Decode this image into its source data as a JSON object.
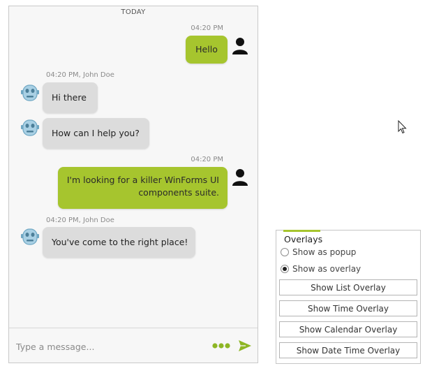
{
  "chat": {
    "day_separator": "TODAY",
    "messages": [
      {
        "meta": "04:20 PM",
        "text": "Hello"
      },
      {
        "meta": "04:20 PM, John Doe",
        "text": "Hi there"
      },
      {
        "text": "How can I help you?"
      },
      {
        "meta": "04:20 PM",
        "text": "I'm looking for a killer WinForms UI components suite."
      },
      {
        "meta": "04:20 PM, John Doe",
        "text": "You've come to the right place!"
      }
    ],
    "input_placeholder": "Type a message...",
    "colors": {
      "outgoing": "#a6c52e",
      "incoming": "#dcdcdc",
      "accent": "#8db624"
    }
  },
  "overlays": {
    "title": "Overlays",
    "options": [
      {
        "label": "Show as popup",
        "checked": false
      },
      {
        "label": "Show as overlay",
        "checked": true
      }
    ],
    "buttons": [
      "Show List Overlay",
      "Show Time Overlay",
      "Show Calendar Overlay",
      "Show Date Time Overlay"
    ]
  }
}
